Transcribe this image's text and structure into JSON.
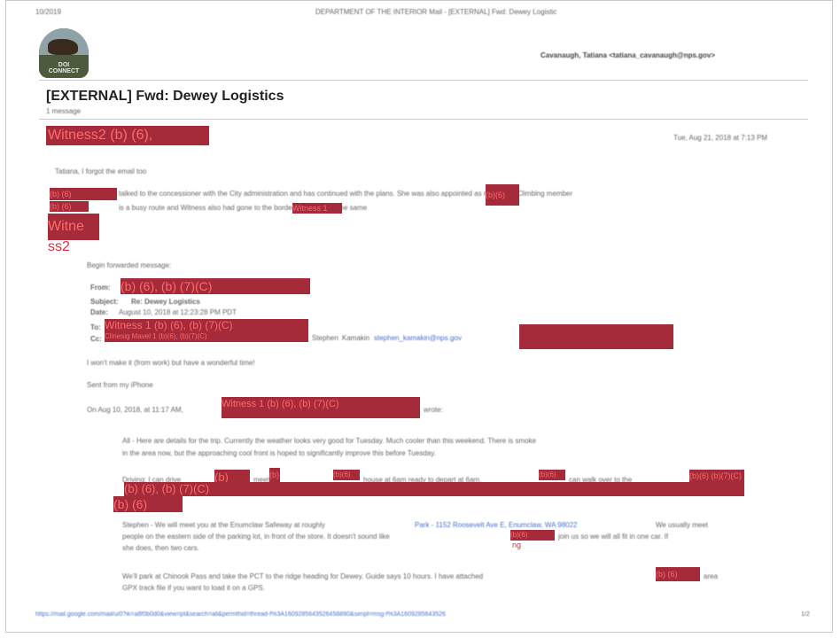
{
  "print_header": {
    "date": "10/2019",
    "window_title": "DEPARTMENT OF THE INTERIOR Mail - [EXTERNAL] Fwd: Dewey Logistic"
  },
  "logo": {
    "line1": "DOI",
    "line2": "CONNECT"
  },
  "recipient": "Cavanaugh, Tatiana <tatiana_cavanaugh@nps.gov>",
  "subject": "[EXTERNAL] Fwd: Dewey Logistics",
  "message_count": "1 message",
  "sender_redaction": "Witness2 (b) (6),",
  "sender_email": "",
  "sent_time": "Tue, Aug 21, 2018 at 7:13 PM",
  "intro_line": "Tatiana, I forgot the email too",
  "body_line1": "talked to the concessioner with the City administration and has continued with the plans. She was also appointed as my official Climbing member",
  "body_line2": "is a busy route and Witness also had gone to the border for being out the same",
  "redactions": {
    "r1": "(b) (6)",
    "r2": "(b) (6)",
    "r3": "(b)(6)",
    "r4": "Witness 1",
    "r5_line1": "Witne",
    "r5_line2": "ss2",
    "from": "(b) (6), (b) (7)(C)",
    "to": "Witness 1 (b) (6), (b) (7)(C)",
    "cc": "Clinesig Mavel 1 (b)(6), (b)(7)(C)",
    "cc_right": "",
    "on_date": "Witness 1 (b) (6), (b) (7)(C)",
    "driving_1": "(b)",
    "driving_2": "(b)",
    "driving_3": "(b)(6)",
    "driving_4": "(b)(6)",
    "driving_5": "(b)(6) (b)(7)(C)",
    "driving_6": "(b) (6), (b) (7)(C)",
    "driving_7": "(b) (6)",
    "stephen_1": "(b)(6)",
    "stephen_2": "ng",
    "attached": "(b) (6)"
  },
  "fwd": {
    "begin": "Begin forwarded message:",
    "from_label": "From:",
    "subject_label": "Subject:",
    "subject_value": "Re: Dewey Logistics",
    "date_label": "Date:",
    "date_value": "August 10, 2018 at 12:23:28 PM PDT",
    "to_label": "To:",
    "cc_label": "Cc:",
    "cc_mid": "Stephen",
    "cc_name": "Kamakin",
    "cc_email": "stephen_kamakin@nps.gov"
  },
  "reply_line": "I won't make it (from work) but have a wonderful time!",
  "sent_from": "Sent from my iPhone",
  "on_date_prefix": "On Aug 10, 2018, at 11:17 AM,",
  "on_date_suffix": "wrote:",
  "quoted": {
    "p1_l1": "All - Here are details for the trip. Currently the weather looks very good for Tuesday. Much cooler than this weekend. There is smoke",
    "p1_l2": "in the area now, but the approaching cool front is hoped to significantly improve this before Tuesday.",
    "driving_l1": "Driving: I can drive",
    "driving_mid1": "meet at",
    "driving_mid2": "house at 6am ready to depart at 6am.",
    "driving_mid3": "can walk over to the",
    "stephen_l1a": "Stephen - We will meet you at the Enumclaw Safeway at roughly",
    "stephen_link": "Park - 1152 Roosevelt Ave E, Enumclaw, WA 98022",
    "stephen_l1b": "We usually meet",
    "stephen_l2": "people on the eastern side of the parking lot, in front of the store. It doesn't sound like",
    "stephen_l2b": "join us so we will all fit in one car. If",
    "stephen_l3": "she does, then two cars.",
    "park_l1": "We'll park at Chinook Pass and take the PCT to the ridge heading for Dewey. Guide says 10 hours. I have attached",
    "park_l1b": "area",
    "park_l2": "GPX track file if you want to load it on a GPS."
  },
  "footer": {
    "url": "https://mail.google.com/mail/u/0?ik=a8f0b0d0&view=pt&search=all&permthid=thread-f%3A1609285643526458890&simpl=msg-f%3A1609285643526",
    "page": "1/2"
  }
}
